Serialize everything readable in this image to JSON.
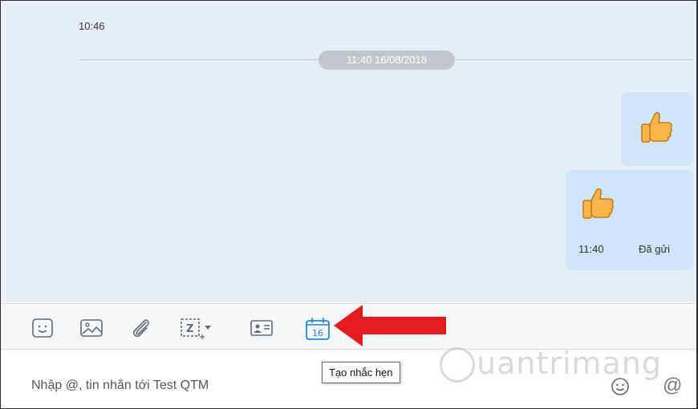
{
  "chat": {
    "previous_time": "10:46",
    "date_separator": "11:40 16/08/2018",
    "messages": [
      {
        "type": "sticker",
        "icon": "thumbs-up-icon"
      },
      {
        "type": "sticker",
        "icon": "thumbs-up-icon",
        "time": "11:40",
        "status": "Đã gửi"
      }
    ]
  },
  "toolbar": {
    "items": [
      {
        "icon": "sticker-icon"
      },
      {
        "icon": "image-icon"
      },
      {
        "icon": "attachment-icon"
      },
      {
        "icon": "screenshot-icon"
      },
      {
        "icon": "contact-card-icon"
      },
      {
        "icon": "calendar-reminder-icon",
        "label": "16"
      },
      {
        "icon": "more-icon"
      }
    ],
    "tooltip": "Tạo nhắc hẹn"
  },
  "composer": {
    "placeholder": "Nhập @, tin nhắn tới Test QTM",
    "mention_symbol": "@"
  },
  "watermark": "uantrimang",
  "colors": {
    "accent": "#1e88e5",
    "bubble": "#cfe6fa",
    "chat_bg": "#e7eef5",
    "arrow": "#e21c1c"
  }
}
